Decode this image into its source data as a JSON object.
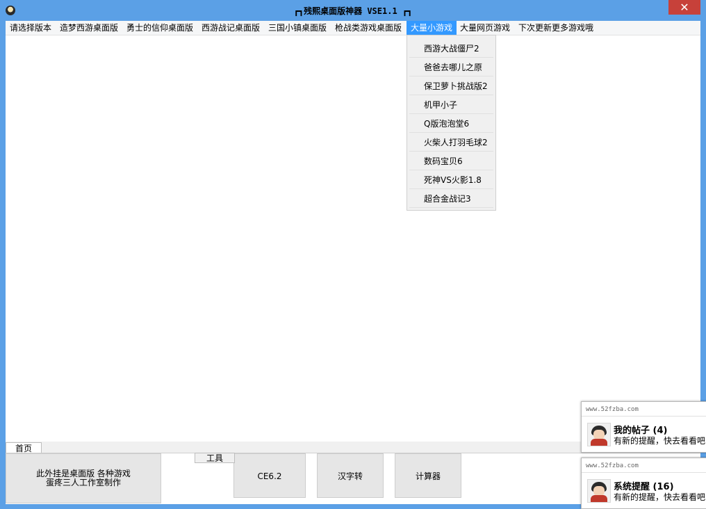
{
  "window": {
    "title": "┏┓残熙桌面版神器 VSE1.1 ┏┓",
    "close_glyph": "✕"
  },
  "menu": {
    "items": [
      "请选择版本",
      "造梦西游桌面版",
      "勇士的信仰桌面版",
      "西游战记桌面版",
      "三国小镇桌面版",
      "枪战类游戏桌面版",
      "大量小游戏",
      "大量网页游戏",
      "下次更新更多游戏哦"
    ],
    "active_index": 6,
    "dropdown_items": [
      "西游大战僵尸2",
      "爸爸去哪儿之原",
      "保卫萝卜挑战版2",
      "机甲小子",
      "Q版泡泡堂6",
      "火柴人打羽毛球2",
      "数码宝贝6",
      "死神VS火影1.8",
      "超合金战记3"
    ]
  },
  "tabs": {
    "home": "首页"
  },
  "panel": {
    "info_line1": "此外挂是桌面版 各种游戏",
    "info_line2": "蛋疼三人工作室制作",
    "group_label": "工具",
    "buttons": [
      "CE6.2",
      "汉字转",
      "计算器"
    ]
  },
  "notifications": [
    {
      "site": "www.52fzba.com",
      "title": "我的帖子",
      "count": "(4)",
      "message": "有新的提醒，快去看看吧"
    },
    {
      "site": "www.52fzba.com",
      "title": "系统提醒",
      "count": "(16)",
      "message": "有新的提醒，快去看看吧"
    }
  ],
  "colors": {
    "titlebar": "#5ba0e6",
    "menu_active": "#3399ff",
    "close": "#c7413a"
  }
}
